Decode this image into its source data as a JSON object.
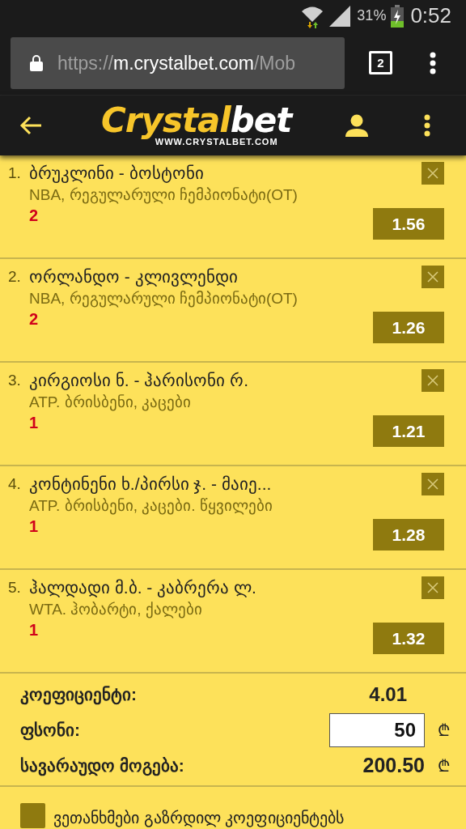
{
  "status_bar": {
    "battery": "31%",
    "time": "0:52"
  },
  "browser": {
    "url_scheme": "https://",
    "url_host": "m.crystalbet.com",
    "url_path": "/Mob",
    "tab_count": "2"
  },
  "header": {
    "logo_main": "Crystal",
    "logo_accent": "bet",
    "logo_site": "WWW.CRYSTALBET.COM"
  },
  "bets": [
    {
      "number": "1.",
      "match": "ბრუკლინი - ბოსტონი",
      "league": "NBA, რეგულარული ჩემპიონატი(OT)",
      "pick": "2",
      "odds": "1.56"
    },
    {
      "number": "2.",
      "match": "ორლანდო - კლივლენდი",
      "league": "NBA, რეგულარული ჩემპიონატი(OT)",
      "pick": "2",
      "odds": "1.26"
    },
    {
      "number": "3.",
      "match": "კირგიოსი ნ. - ჰარისონი რ.",
      "league": "ATP. ბრისბენი, კაცები",
      "pick": "1",
      "odds": "1.21"
    },
    {
      "number": "4.",
      "match": "კონტინენი ხ./პირსი ჯ. - მაიე...",
      "league": "ATP. ბრისბენი, კაცები. წყვილები",
      "pick": "1",
      "odds": "1.28"
    },
    {
      "number": "5.",
      "match": "ჰალდადი მ.ბ. - კაბრერა ლ.",
      "league": "WTA. ჰობარტი, ქალები",
      "pick": "1",
      "odds": "1.32"
    }
  ],
  "summary": {
    "odds_label": "კოეფიციენტი:",
    "odds_value": "4.01",
    "stake_label": "ფსონი:",
    "stake_value": "50",
    "stake_currency": "₾",
    "win_label": "სავარაუდო მოგება:",
    "win_value": "200.50",
    "win_currency": "₾"
  },
  "accept": {
    "label": "ვეთანხმები გაზრდილ კოეფიციენტებს",
    "checked": false
  }
}
